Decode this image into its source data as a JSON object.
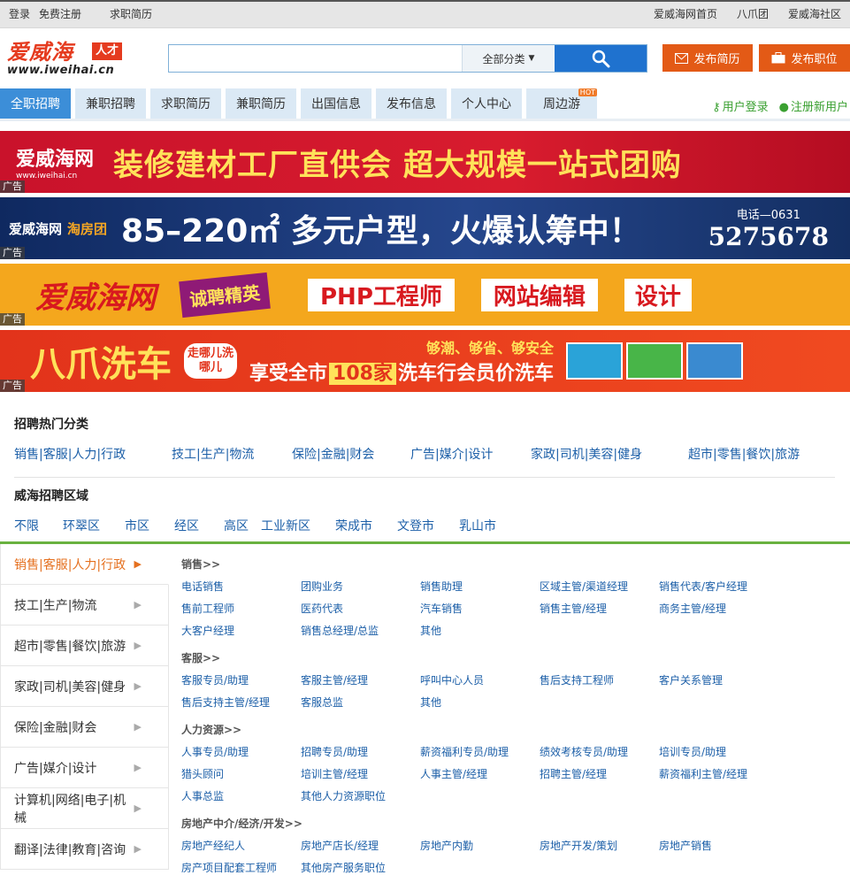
{
  "topbar": {
    "login": "登录",
    "register": "免费注册",
    "resume_seek": "求职简历",
    "links": [
      "爱威海网首页",
      "八爪团",
      "爱威海社区"
    ]
  },
  "logo": {
    "name": "爱威海",
    "tag": "人才",
    "url": "www.iweihai.cn"
  },
  "search": {
    "value": "",
    "category": "全部分类",
    "category_arrow": "▼"
  },
  "header_buttons": {
    "post_resume": "发布简历",
    "post_job": "发布职位"
  },
  "nav": {
    "tabs": [
      "全职招聘",
      "兼职招聘",
      "求职简历",
      "兼职简历",
      "出国信息",
      "发布信息",
      "个人中心",
      "周边游"
    ],
    "hot_badge": "HOT",
    "user_login": "用户登录",
    "register_user": "注册新用户"
  },
  "banners": [
    {
      "logo": "爱威海网",
      "logo_url": "www.iweihai.cn",
      "text": "装修建材工厂直供会  超大规模一站式团购",
      "ad": "广告"
    },
    {
      "logo": "爱威海网",
      "logo_sub": "淘房团",
      "text": "85–220㎡ 多元户型，火爆认筹中！",
      "phone_label": "电话—0631",
      "phone": "5275678",
      "ad": "广告"
    },
    {
      "logo": "爱威海网",
      "badge": "诚聘精英",
      "jobs": [
        "PHP工程师",
        "网站编辑",
        "设计"
      ],
      "ad": "广告"
    },
    {
      "logo": "八爪洗车",
      "badge": "走哪儿洗哪儿",
      "slogan": "够潮、够省、够安全",
      "text_a": "享受全市",
      "count": "108家",
      "text_b": "洗车行会员价洗车",
      "ad": "广告"
    }
  ],
  "hot_categories": {
    "title": "招聘热门分类",
    "items": [
      "销售|客服|人力|行政",
      "技工|生产|物流",
      "保险|金融|财会",
      "广告|媒介|设计",
      "家政|司机|美容|健身",
      "超市|零售|餐饮|旅游"
    ]
  },
  "areas": {
    "title": "威海招聘区域",
    "items": [
      "不限",
      "环翠区",
      "市区",
      "经区",
      "高区",
      "工业新区",
      "荣成市",
      "文登市",
      "乳山市"
    ]
  },
  "category_list": [
    "销售|客服|人力|行政",
    "技工|生产|物流",
    "超市|零售|餐饮|旅游",
    "家政|司机|美容|健身",
    "保险|金融|财会",
    "广告|媒介|设计",
    "计算机|网络|电子|机械",
    "翻译|法律|教育|咨询"
  ],
  "detail_groups": [
    {
      "title": "销售>>",
      "items": [
        "电话销售",
        "团购业务",
        "销售助理",
        "区域主管/渠道经理",
        "销售代表/客户经理",
        "售前工程师",
        "医药代表",
        "汽车销售",
        "销售主管/经理",
        "商务主管/经理",
        "大客户经理",
        "销售总经理/总监",
        "其他"
      ]
    },
    {
      "title": "客服>>",
      "items": [
        "客服专员/助理",
        "客服主管/经理",
        "呼叫中心人员",
        "售后支持工程师",
        "客户关系管理",
        "售后支持主管/经理",
        "客服总监",
        "其他"
      ]
    },
    {
      "title": "人力资源>>",
      "items": [
        "人事专员/助理",
        "招聘专员/助理",
        "薪资福利专员/助理",
        "绩效考核专员/助理",
        "培训专员/助理",
        "猎头顾问",
        "培训主管/经理",
        "人事主管/经理",
        "招聘主管/经理",
        "薪资福利主管/经理",
        "人事总监",
        "其他人力资源职位"
      ]
    },
    {
      "title": "房地产中介/经济/开发>>",
      "items": [
        "房地产经纪人",
        "房地产店长/经理",
        "房地产内勤",
        "房地产开发/策划",
        "房地产销售",
        "房产项目配套工程师",
        "其他房产服务职位"
      ]
    }
  ],
  "colors": {
    "accent_blue": "#3c8ed8",
    "orange": "#e35a16",
    "green": "#69b23f",
    "link": "#1c5fa8"
  }
}
